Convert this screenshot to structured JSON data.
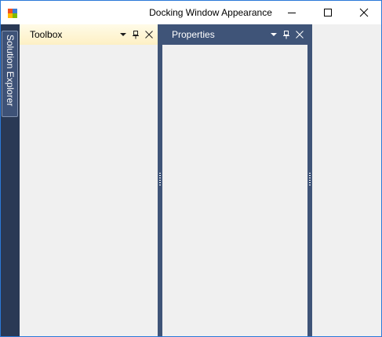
{
  "window": {
    "title": "Docking Window Appearance",
    "border_color": "#2b79d8",
    "icon": "app-icon"
  },
  "caption_buttons": {
    "minimize": "minimize-icon",
    "maximize": "maximize-icon",
    "close": "close-icon"
  },
  "autohide": {
    "tab_label": "Solution Explorer",
    "strip_color": "#2a3955"
  },
  "toolbox": {
    "title": "Toolbox",
    "state": "active",
    "header_color": "#fdf0c4",
    "buttons": [
      "dropdown-icon",
      "pin-icon",
      "close-icon"
    ]
  },
  "properties": {
    "title": "Properties",
    "header_color": "#3f5478",
    "buttons": [
      "dropdown-icon",
      "pin-icon",
      "close-icon"
    ]
  }
}
